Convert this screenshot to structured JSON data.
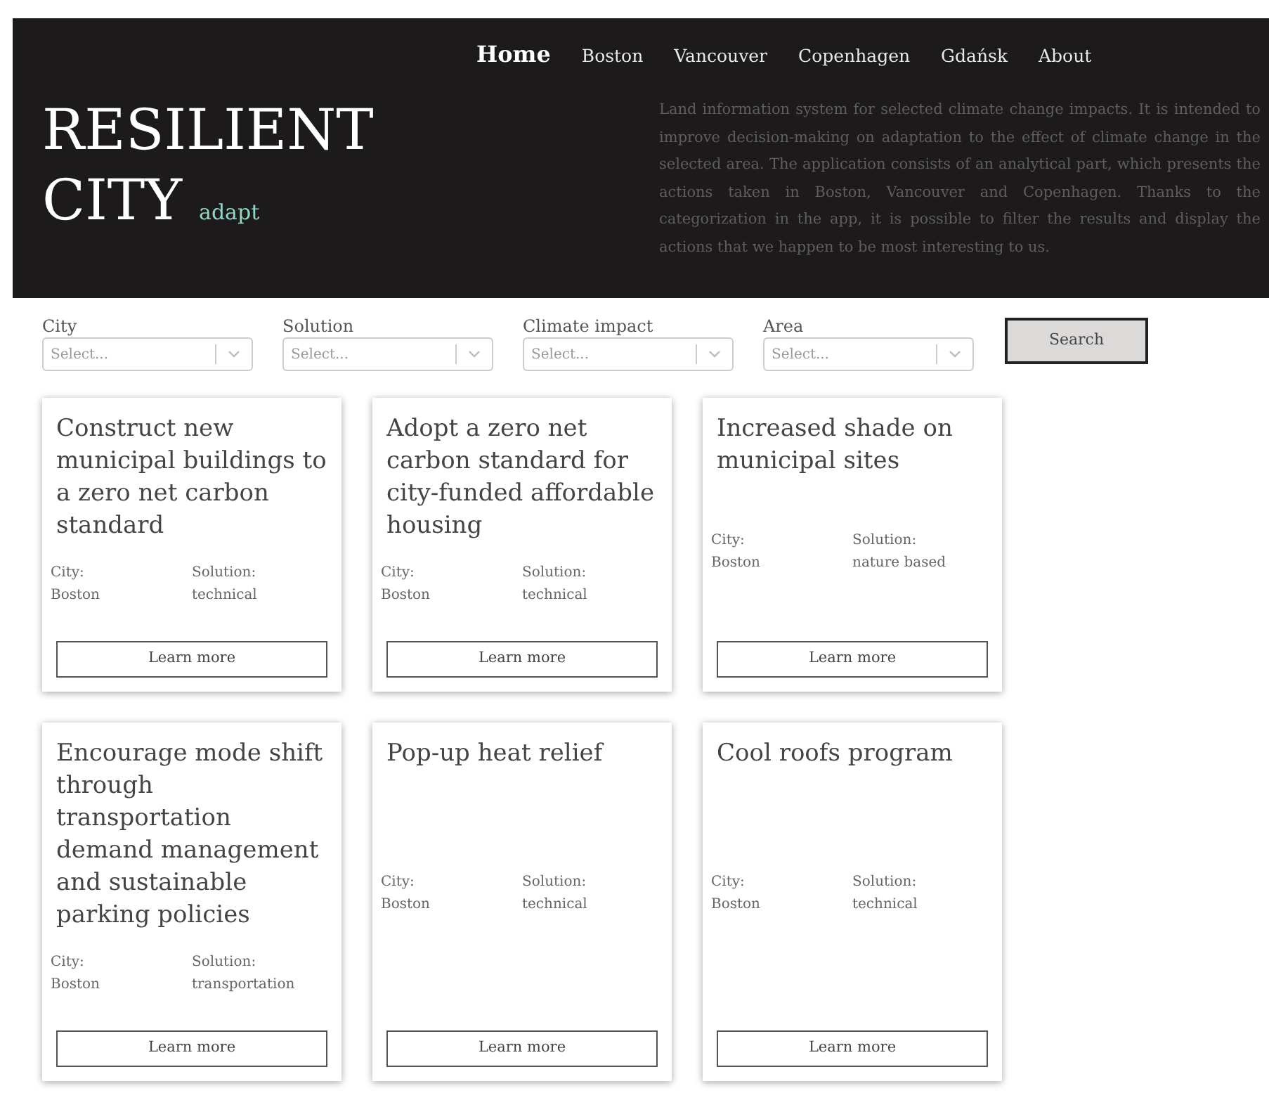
{
  "nav": [
    {
      "label": "Home",
      "selected": true
    },
    {
      "label": "Boston",
      "selected": false
    },
    {
      "label": "Vancouver",
      "selected": false
    },
    {
      "label": "Copenhagen",
      "selected": false
    },
    {
      "label": "Gdańsk",
      "selected": false
    },
    {
      "label": "About",
      "selected": false
    }
  ],
  "brand": {
    "title_line1": "RESILIENT",
    "title_line2": "CITY",
    "tagline": "adapt"
  },
  "description": "Land information system for selected climate change impacts. It is intended to improve decision-making on adaptation to the effect of climate change in the selected area. The application consists of an analytical part, which presents the actions taken in Boston, Vancouver and Copenhagen. Thanks to the categorization in the app, it is possible to filter the results and display the actions that we happen to be most interesting to us.",
  "filters": [
    {
      "label": "City",
      "placeholder": "Select..."
    },
    {
      "label": "Solution",
      "placeholder": "Select..."
    },
    {
      "label": "Climate impact",
      "placeholder": "Select..."
    },
    {
      "label": "Area",
      "placeholder": "Select..."
    }
  ],
  "search_button": "Search",
  "cards": [
    {
      "title": "Construct new municipal buildings to a zero net carbon standard",
      "city_label": "City:",
      "city": "Boston",
      "solution_label": "Solution:",
      "solution": "technical",
      "button": "Learn more"
    },
    {
      "title": "Adopt a zero net carbon standard for city-funded affordable housing",
      "city_label": "City:",
      "city": "Boston",
      "solution_label": "Solution:",
      "solution": "technical",
      "button": "Learn more"
    },
    {
      "title": "Increased shade on municipal sites",
      "city_label": "City:",
      "city": "Boston",
      "solution_label": "Solution:",
      "solution": "nature based",
      "button": "Learn more"
    },
    {
      "title": "Encourage mode shift through transportation demand management and sustainable parking policies",
      "city_label": "City:",
      "city": "Boston",
      "solution_label": "Solution:",
      "solution": "transportation",
      "button": "Learn more"
    },
    {
      "title": "Pop-up heat relief",
      "city_label": "City:",
      "city": "Boston",
      "solution_label": "Solution:",
      "solution": "technical",
      "button": "Learn more"
    },
    {
      "title": "Cool roofs program",
      "city_label": "City:",
      "city": "Boston",
      "solution_label": "Solution:",
      "solution": "technical",
      "button": "Learn more"
    }
  ]
}
